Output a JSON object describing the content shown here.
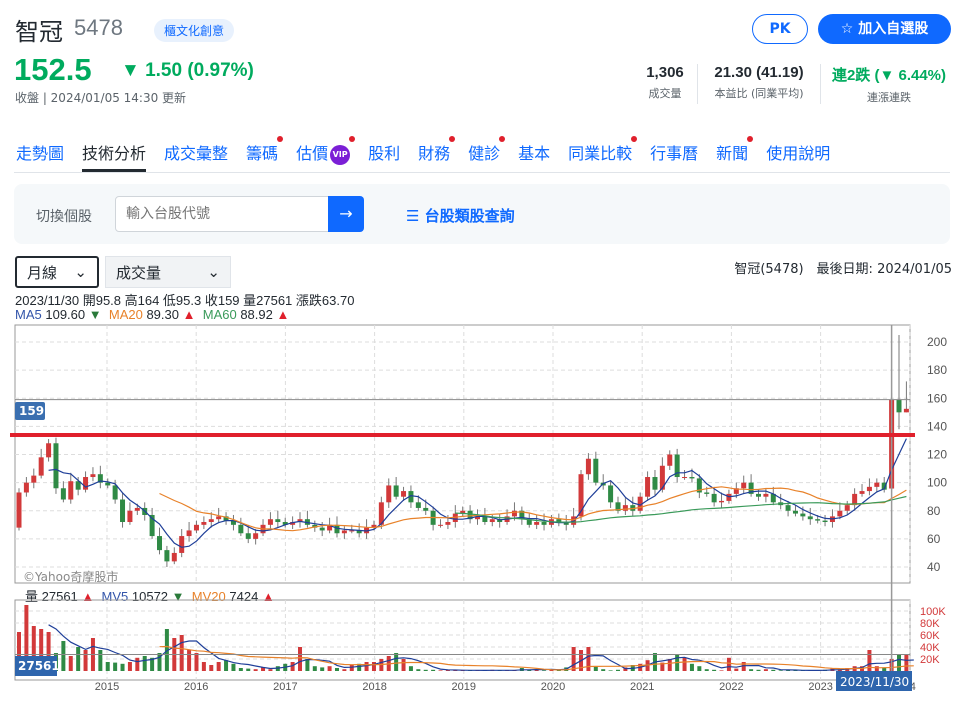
{
  "header": {
    "name": "智冠",
    "code": "5478",
    "tag": "櫃文化創意",
    "price": "152.5",
    "change": "▼ 1.50 (0.97%)",
    "update": "收盤 | 2024/01/05 14:30 更新",
    "pk": "PK",
    "add": "加入自選股"
  },
  "stats": [
    {
      "value": "1,306",
      "label": "成交量"
    },
    {
      "value": "21.30 (41.19)",
      "label": "本益比 (同業平均)"
    },
    {
      "value": "連2跌 (▼ 6.44%)",
      "label": "連漲連跌"
    }
  ],
  "tabs": [
    {
      "label": "走勢圖",
      "dot": false
    },
    {
      "label": "技術分析",
      "dot": false,
      "active": true
    },
    {
      "label": "成交彙整",
      "dot": false
    },
    {
      "label": "籌碼",
      "dot": true
    },
    {
      "label": "估價",
      "dot": true,
      "vip": "VIP"
    },
    {
      "label": "股利",
      "dot": false
    },
    {
      "label": "財務",
      "dot": true
    },
    {
      "label": "健診",
      "dot": true
    },
    {
      "label": "基本",
      "dot": false
    },
    {
      "label": "同業比較",
      "dot": true
    },
    {
      "label": "行事曆",
      "dot": false
    },
    {
      "label": "新聞",
      "dot": true
    },
    {
      "label": "使用說明",
      "dot": false
    }
  ],
  "search": {
    "label": "切換個股",
    "placeholder": "輸入台股代號",
    "go": "→",
    "category": "☰ 台股類股查詢"
  },
  "controls": {
    "period": "月線",
    "indicator": "成交量",
    "meta": "智冠(5478)　最後日期: 2024/01/05"
  },
  "info": {
    "ohlc": "2023/11/30 開95.8 高164 低95.3 收159 量27561 漲跌63.70",
    "ma5_label": "MA5",
    "ma5": "109.60",
    "ma20_label": "MA20",
    "ma20": "89.30",
    "ma60_label": "MA60",
    "ma60": "88.92",
    "vol_label": "量",
    "vol": "27561",
    "mv5_label": "MV5",
    "mv5": "10572",
    "mv20_label": "MV20",
    "mv20": "7424",
    "up": "▲",
    "down": "▼"
  },
  "chart_data": {
    "type": "candlestick",
    "start_month": "2014/01",
    "closes": [
      93,
      100,
      105,
      118,
      128,
      96,
      88,
      101,
      95,
      104,
      106,
      100,
      98,
      88,
      72,
      80,
      82,
      77,
      62,
      52,
      44,
      50,
      62,
      66,
      70,
      72,
      74,
      76,
      73,
      70,
      64,
      60,
      64,
      70,
      74,
      72,
      70,
      72,
      74,
      70,
      68,
      66,
      70,
      64,
      66,
      66,
      64,
      68,
      70,
      86,
      98,
      90,
      94,
      86,
      82,
      80,
      70,
      70,
      72,
      78,
      80,
      74,
      76,
      72,
      74,
      72,
      76,
      80,
      74,
      70,
      72,
      70,
      74,
      72,
      70,
      76,
      106,
      117,
      100,
      98,
      86,
      80,
      84,
      80,
      90,
      104,
      95,
      112,
      120,
      104,
      104,
      103,
      93,
      92,
      86,
      87,
      92,
      96,
      100,
      92,
      90,
      92,
      86,
      84,
      80,
      78,
      76,
      74,
      73,
      72,
      76,
      80,
      84,
      92,
      94,
      97,
      100,
      95,
      159,
      150,
      152.5
    ],
    "special": {
      "118": {
        "o": 95.8,
        "h": 164,
        "l": 95.3,
        "c": 159
      },
      "119": {
        "o": 159,
        "h": 205,
        "l": 138,
        "c": 150
      },
      "120": {
        "o": 150,
        "h": 172,
        "l": 150,
        "c": 152.5
      }
    },
    "volumes_k": [
      65,
      110,
      75,
      70,
      65,
      30,
      50,
      25,
      40,
      35,
      55,
      35,
      15,
      14,
      12,
      15,
      22,
      25,
      22,
      30,
      70,
      55,
      60,
      35,
      30,
      15,
      10,
      15,
      18,
      12,
      5,
      4,
      3,
      6,
      3,
      8,
      12,
      15,
      40,
      20,
      8,
      6,
      8,
      5,
      3,
      10,
      12,
      15,
      15,
      20,
      25,
      30,
      20,
      8,
      3,
      2,
      2,
      1,
      2,
      1,
      1,
      1,
      1,
      1,
      2,
      1,
      1,
      1,
      5,
      2,
      3,
      1,
      3,
      2,
      6,
      40,
      35,
      40,
      8,
      3,
      1,
      2,
      6,
      10,
      12,
      18,
      30,
      14,
      20,
      28,
      22,
      12,
      8,
      3,
      2,
      1,
      22,
      4,
      15,
      3,
      2,
      3,
      2,
      1,
      1,
      1,
      1,
      1,
      1,
      2,
      4,
      3,
      5,
      8,
      8,
      35,
      8,
      6,
      20,
      27.561,
      28,
      10
    ],
    "y_ticks": [
      200,
      180,
      160,
      140,
      120,
      100,
      80,
      60,
      40
    ],
    "vol_ticks": [
      "100K",
      "80K",
      "60K",
      "40K",
      "20K"
    ],
    "x_labels": [
      "2015",
      "2016",
      "2017",
      "2018",
      "2019",
      "2020",
      "2021",
      "2022",
      "2023",
      "24"
    ],
    "last_price_label": "159",
    "vol_label_box": "27561",
    "date_label_box": "2023/11/30",
    "watermark": "©Yahoo奇摩股市",
    "colors": {
      "up": "#d2393a",
      "down": "#2f8a45",
      "ma5": "#1f3f99",
      "ma20": "#e8822a",
      "ma60": "#3a9a5a",
      "resistance": "#e0202c"
    }
  }
}
